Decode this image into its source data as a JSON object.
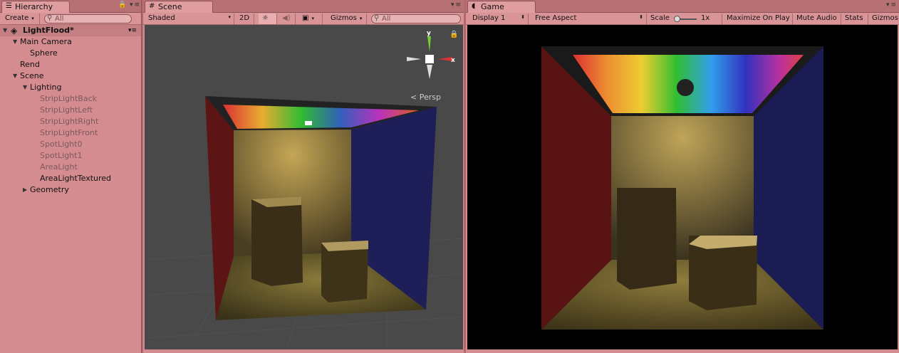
{
  "hierarchy": {
    "tab_label": "Hierarchy",
    "create_label": "Create",
    "search_placeholder": "All",
    "scene_name": "LightFlood*",
    "items": [
      {
        "label": "Main Camera",
        "depth": 1,
        "expanded": true
      },
      {
        "label": "Sphere",
        "depth": 2
      },
      {
        "label": "Rend",
        "depth": 1
      },
      {
        "label": "Scene",
        "depth": 1,
        "expanded": true
      },
      {
        "label": "Lighting",
        "depth": 2,
        "expanded": true
      },
      {
        "label": "StripLightBack",
        "depth": 3,
        "disabled": true
      },
      {
        "label": "StripLightLeft",
        "depth": 3,
        "disabled": true
      },
      {
        "label": "StripLightRight",
        "depth": 3,
        "disabled": true
      },
      {
        "label": "StripLightFront",
        "depth": 3,
        "disabled": true
      },
      {
        "label": "SpotLight0",
        "depth": 3,
        "disabled": true
      },
      {
        "label": "SpotLight1",
        "depth": 3,
        "disabled": true
      },
      {
        "label": "AreaLight",
        "depth": 3,
        "disabled": true
      },
      {
        "label": "AreaLightTextured",
        "depth": 3
      },
      {
        "label": "Geometry",
        "depth": 2,
        "collapsed": true
      }
    ]
  },
  "scene": {
    "tab_label": "Scene",
    "shading_mode": "Shaded",
    "mode_2d": "2D",
    "gizmos_label": "Gizmos",
    "search_placeholder": "All",
    "projection_label": "Persp",
    "axis_y": "y",
    "axis_x": "x"
  },
  "game": {
    "tab_label": "Game",
    "display": "Display 1",
    "aspect": "Free Aspect",
    "scale_label": "Scale",
    "scale_value": "1x",
    "maximize_label": "Maximize On Play",
    "mute_label": "Mute Audio",
    "stats_label": "Stats",
    "gizmos_label": "Gizmos"
  },
  "colors": {
    "play_tint": "#d48c90",
    "left_wall": "#6b1616",
    "right_wall": "#1e1e5a",
    "floor": "#6b5a2e"
  }
}
